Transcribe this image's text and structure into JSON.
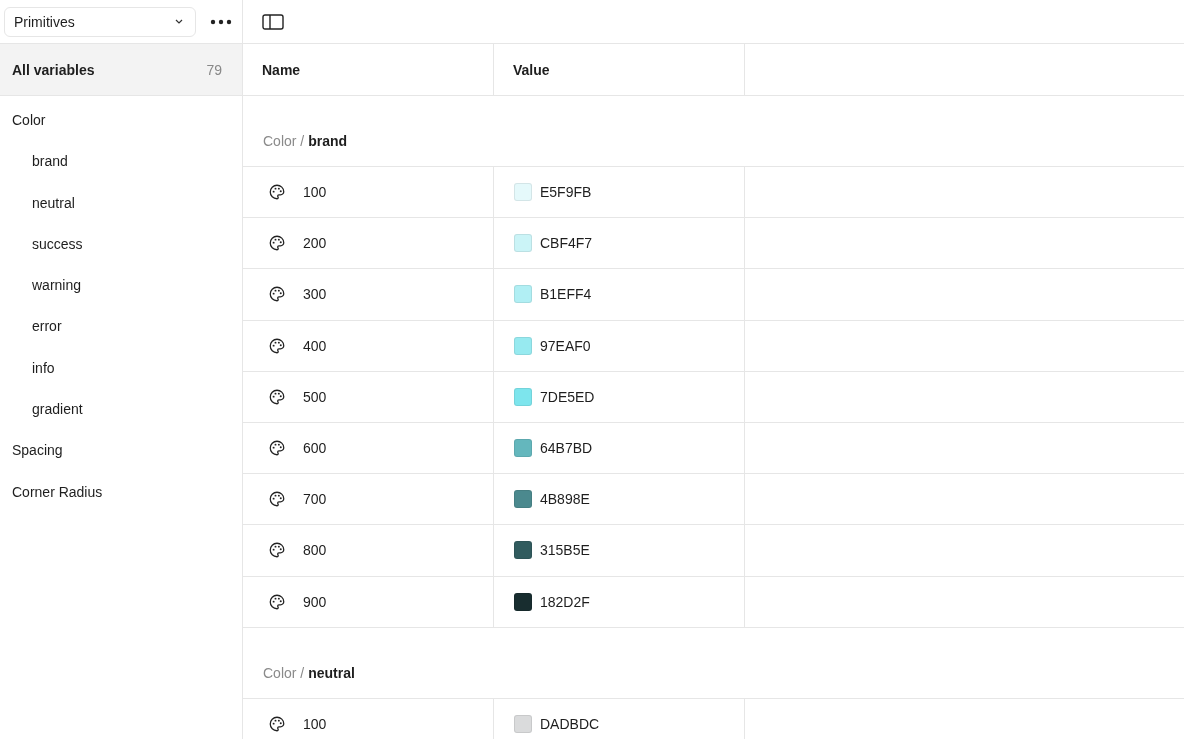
{
  "collection_select": {
    "value": "Primitives"
  },
  "sidebar": {
    "all": {
      "label": "All variables",
      "count": "79",
      "selected": true
    },
    "items": [
      {
        "label": "Color",
        "selected": false,
        "children": [
          {
            "label": "brand",
            "selected": false
          },
          {
            "label": "neutral",
            "selected": false
          },
          {
            "label": "success",
            "selected": false
          },
          {
            "label": "warning",
            "selected": false
          },
          {
            "label": "error",
            "selected": false
          },
          {
            "label": "info",
            "selected": false
          },
          {
            "label": "gradient",
            "selected": false
          }
        ]
      },
      {
        "label": "Spacing",
        "selected": false
      },
      {
        "label": "Corner Radius",
        "selected": false
      }
    ]
  },
  "table": {
    "columns": [
      "Name",
      "Value"
    ],
    "groups": [
      {
        "path": "Color / ",
        "name": "brand",
        "rows": [
          {
            "name": "100",
            "value": "E5F9FB",
            "color": "#e5f9fb"
          },
          {
            "name": "200",
            "value": "CBF4F7",
            "color": "#cbf4f7"
          },
          {
            "name": "300",
            "value": "B1EFF4",
            "color": "#b1eff4"
          },
          {
            "name": "400",
            "value": "97EAF0",
            "color": "#97eaf0"
          },
          {
            "name": "500",
            "value": "7DE5ED",
            "color": "#7de5ed"
          },
          {
            "name": "600",
            "value": "64B7BD",
            "color": "#64b7bd"
          },
          {
            "name": "700",
            "value": "4B898E",
            "color": "#4b898e"
          },
          {
            "name": "800",
            "value": "315B5E",
            "color": "#315b5e"
          },
          {
            "name": "900",
            "value": "182D2F",
            "color": "#182d2f"
          }
        ]
      },
      {
        "path": "Color / ",
        "name": "neutral",
        "rows": [
          {
            "name": "100",
            "value": "DADBDC",
            "color": "#dadbdc"
          }
        ]
      }
    ]
  }
}
